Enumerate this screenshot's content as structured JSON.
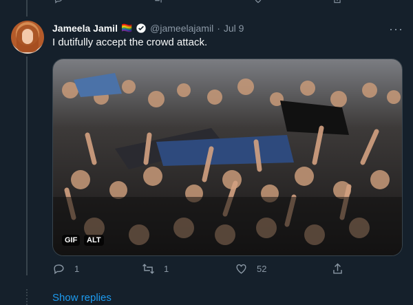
{
  "tweet": {
    "author_name": "Jameela Jamil",
    "author_emoji": "🏳️‍🌈",
    "handle": "@jameelajamil",
    "separator": "·",
    "date": "Jul 9",
    "more_label": "···",
    "text": "I dutifully accept the crowd attack.",
    "media": {
      "gif_badge": "GIF",
      "alt_badge": "ALT",
      "description_icon": "crowd-surfing-gif"
    },
    "actions": {
      "reply_count": "1",
      "retweet_count": "1",
      "like_count": "52"
    }
  },
  "thread": {
    "show_replies": "Show replies"
  },
  "colors": {
    "background": "#15202b",
    "text": "#f7f9f9",
    "secondary": "#8b98a5",
    "accent": "#1d9bf0",
    "line": "#38444d"
  }
}
